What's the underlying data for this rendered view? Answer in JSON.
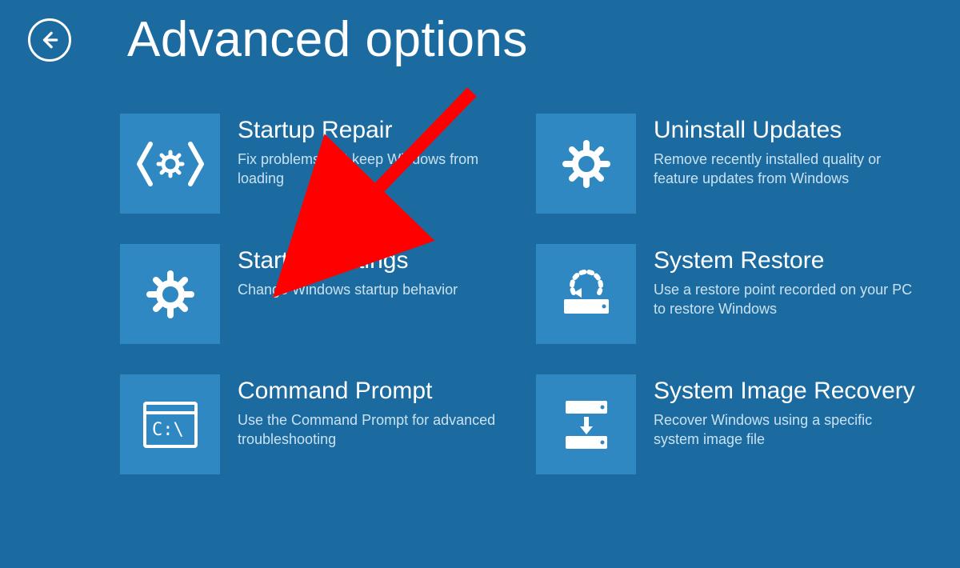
{
  "header": {
    "title": "Advanced options"
  },
  "tiles": [
    {
      "title": "Startup Repair",
      "desc": "Fix problems that keep Windows from loading"
    },
    {
      "title": "Uninstall Updates",
      "desc": "Remove recently installed quality or feature updates from Windows"
    },
    {
      "title": "Startup Settings",
      "desc": "Change Windows startup behavior"
    },
    {
      "title": "System Restore",
      "desc": "Use a restore point recorded on your PC to restore Windows"
    },
    {
      "title": "Command Prompt",
      "desc": "Use the Command Prompt for advanced troubleshooting"
    },
    {
      "title": "System Image Recovery",
      "desc": "Recover Windows using a specific system image file"
    }
  ],
  "annotation": {
    "arrow_color": "#ff0000"
  }
}
